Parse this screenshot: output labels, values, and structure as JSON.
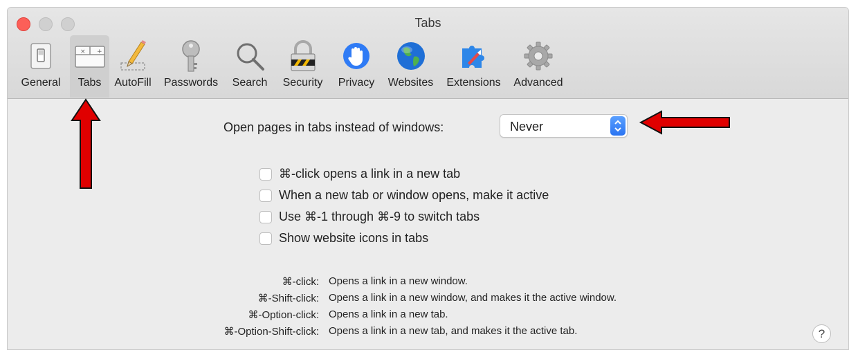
{
  "window": {
    "title": "Tabs"
  },
  "toolbar": {
    "items": [
      {
        "label": "General",
        "icon": "switch-icon"
      },
      {
        "label": "Tabs",
        "icon": "tabs-icon",
        "selected": true
      },
      {
        "label": "AutoFill",
        "icon": "pencil-icon"
      },
      {
        "label": "Passwords",
        "icon": "key-icon"
      },
      {
        "label": "Search",
        "icon": "magnifier-icon"
      },
      {
        "label": "Security",
        "icon": "lock-icon"
      },
      {
        "label": "Privacy",
        "icon": "hand-icon"
      },
      {
        "label": "Websites",
        "icon": "globe-icon"
      },
      {
        "label": "Extensions",
        "icon": "puzzle-icon"
      },
      {
        "label": "Advanced",
        "icon": "gear-icon"
      }
    ]
  },
  "open_pages": {
    "label": "Open pages in tabs instead of windows:",
    "value": "Never"
  },
  "checkboxes": [
    {
      "label": "⌘-click opens a link in a new tab",
      "checked": false
    },
    {
      "label": "When a new tab or window opens, make it active",
      "checked": false
    },
    {
      "label": "Use ⌘-1 through ⌘-9 to switch tabs",
      "checked": false
    },
    {
      "label": "Show website icons in tabs",
      "checked": false
    }
  ],
  "help": [
    {
      "key": "⌘-click:",
      "desc": "Opens a link in a new window."
    },
    {
      "key": "⌘-Shift-click:",
      "desc": "Opens a link in a new window, and makes it the active window."
    },
    {
      "key": "⌘-Option-click:",
      "desc": "Opens a link in a new tab."
    },
    {
      "key": "⌘-Option-Shift-click:",
      "desc": "Opens a link in a new tab, and makes it the active tab."
    }
  ],
  "help_button": "?",
  "colors": {
    "accent": "#2a74f2",
    "close": "#fc5f58",
    "annotation_arrow": "#e00000"
  }
}
